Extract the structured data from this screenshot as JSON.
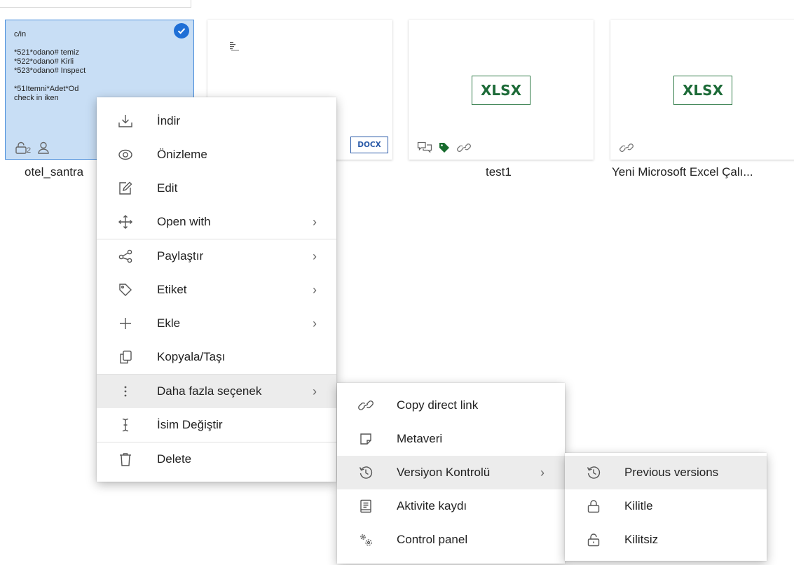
{
  "files": [
    {
      "name": "otel_santra",
      "selected": true,
      "preview_text": "c/in\n\n*521*odano# temiz\n*522*odano# Kirli\n*523*odano# Inspect\n\n*51Itemni*Adet*Od\ncheck in iken",
      "lock_count": "2"
    },
    {
      "name": "",
      "badge": "DOCX"
    },
    {
      "name": "test1",
      "badge": "XLSX"
    },
    {
      "name": "Yeni Microsoft Excel Çalı...",
      "badge": "XLSX"
    }
  ],
  "context_menu": {
    "items": [
      {
        "label": "İndir",
        "icon": "download-icon"
      },
      {
        "label": "Önizleme",
        "icon": "eye-icon"
      },
      {
        "label": "Edit",
        "icon": "edit-icon"
      },
      {
        "label": "Open with",
        "icon": "move-arrows-icon",
        "submenu": true
      },
      {
        "label": "Paylaştır",
        "icon": "share-icon",
        "submenu": true
      },
      {
        "label": "Etiket",
        "icon": "tag-icon",
        "submenu": true
      },
      {
        "label": "Ekle",
        "icon": "plus-icon",
        "submenu": true
      },
      {
        "label": "Kopyala/Taşı",
        "icon": "copy-icon"
      },
      {
        "label": "Daha fazla seçenek",
        "icon": "more-vertical-icon",
        "submenu": true,
        "active": true
      },
      {
        "label": "İsim Değiştir",
        "icon": "text-cursor-icon"
      },
      {
        "label": "Delete",
        "icon": "trash-icon"
      }
    ]
  },
  "more_submenu": {
    "items": [
      {
        "label": "Copy direct link",
        "icon": "link-icon"
      },
      {
        "label": "Metaveri",
        "icon": "note-icon"
      },
      {
        "label": "Versiyon Kontrolü",
        "icon": "history-icon",
        "submenu": true,
        "active": true
      },
      {
        "label": "Aktivite kaydı",
        "icon": "activity-log-icon"
      },
      {
        "label": "Control panel",
        "icon": "gears-icon"
      }
    ]
  },
  "version_submenu": {
    "items": [
      {
        "label": "Previous versions",
        "icon": "history-icon",
        "active": true
      },
      {
        "label": "Kilitle",
        "icon": "lock-icon"
      },
      {
        "label": "Kilitsiz",
        "icon": "unlock-icon"
      }
    ]
  },
  "chevron": "›"
}
